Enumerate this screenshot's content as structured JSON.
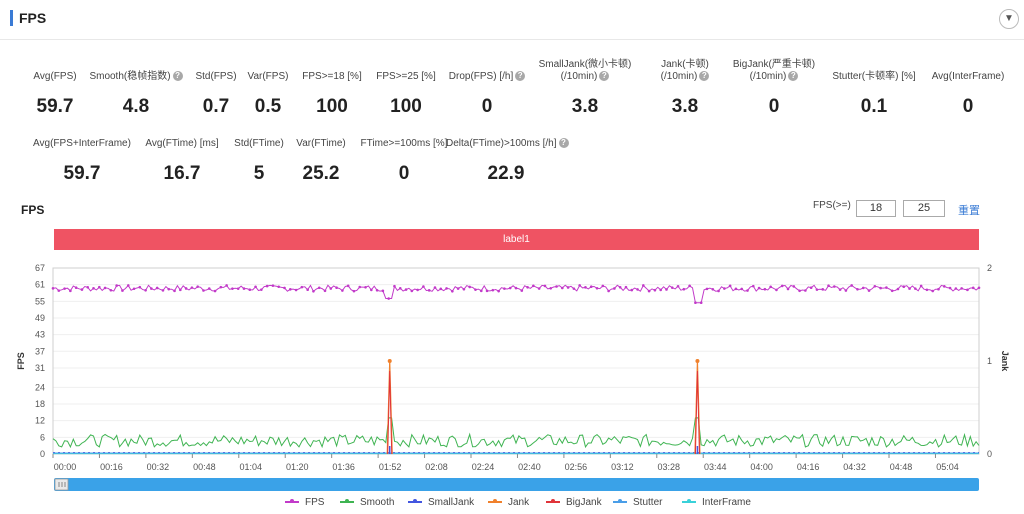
{
  "header": {
    "title": "FPS",
    "collapse_icon": "chevron-down-icon"
  },
  "metrics_row1": [
    {
      "label": "Avg(FPS)",
      "value": "59.7",
      "help": false
    },
    {
      "label": "Smooth(稳帧指数)",
      "value": "4.8",
      "help": true
    },
    {
      "label": "Std(FPS)",
      "value": "0.7",
      "help": false
    },
    {
      "label": "Var(FPS)",
      "value": "0.5",
      "help": false
    },
    {
      "label": "FPS>=18 [%]",
      "value": "100",
      "help": false
    },
    {
      "label": "FPS>=25 [%]",
      "value": "100",
      "help": false
    },
    {
      "label": "Drop(FPS) [/h]",
      "value": "0",
      "help": true
    },
    {
      "label": "SmallJank(微小卡顿)",
      "label2": "(/10min)",
      "value": "3.8",
      "help": true
    },
    {
      "label": "Jank(卡顿)",
      "label2": "(/10min)",
      "value": "3.8",
      "help": true
    },
    {
      "label": "BigJank(严重卡顿)",
      "label2": "(/10min)",
      "value": "0",
      "help": true
    },
    {
      "label": "Stutter(卡顿率) [%]",
      "value": "0.1",
      "help": false
    },
    {
      "label": "Avg(InterFrame)",
      "value": "0",
      "help": false
    }
  ],
  "metrics_row2": [
    {
      "label": "Avg(FPS+InterFrame)",
      "value": "59.7",
      "help": false
    },
    {
      "label": "Avg(FTime) [ms]",
      "value": "16.7",
      "help": false
    },
    {
      "label": "Std(FTime)",
      "value": "5",
      "help": false
    },
    {
      "label": "Var(FTime)",
      "value": "25.2",
      "help": false
    },
    {
      "label": "FTime>=100ms [%]",
      "value": "0",
      "help": false
    },
    {
      "label": "Delta(FTime)>100ms [/h]",
      "value": "22.9",
      "help": true
    }
  ],
  "controls": {
    "chart_title": "FPS",
    "fps_threshold_label": "FPS(>=)",
    "fps_threshold_1": "18",
    "fps_threshold_2": "25",
    "reset_label": "重置",
    "label_band": "label1"
  },
  "colors": {
    "fps": "#c23ac9",
    "smooth": "#3fb452",
    "smalljank": "#4356e0",
    "jank": "#f0812c",
    "bigjank": "#e0343a",
    "stutter": "#4a9ee8",
    "interframe": "#3ad1d9",
    "label_band": "#ef5363",
    "accent": "#3a7bd5"
  },
  "chart_data": {
    "type": "line",
    "xlabel": "",
    "ylabel": "FPS",
    "y2label": "Jank",
    "ylim": [
      0,
      67
    ],
    "y_ticks": [
      0,
      6,
      12,
      18,
      24,
      31,
      37,
      43,
      49,
      55,
      61,
      67
    ],
    "y2lim": [
      0,
      2
    ],
    "y2_ticks": [
      0,
      1,
      2
    ],
    "x_ticks": [
      "00:00",
      "00:16",
      "00:32",
      "00:48",
      "01:04",
      "01:20",
      "01:36",
      "01:52",
      "02:08",
      "02:24",
      "02:40",
      "02:56",
      "03:12",
      "03:28",
      "03:44",
      "04:00",
      "04:16",
      "04:32",
      "04:48",
      "05:04"
    ],
    "x_range_seconds": [
      0,
      319
    ],
    "legend_position": "bottom",
    "series": [
      {
        "name": "FPS",
        "axis": "left",
        "typical": 59.7,
        "dips": [
          {
            "t": 116,
            "value": 56
          },
          {
            "t": 222,
            "value": 54.5
          }
        ]
      },
      {
        "name": "Smooth",
        "axis": "left",
        "typical": 4.8,
        "range": [
          1,
          8
        ],
        "spikes": [
          {
            "t": 116,
            "value": 13
          },
          {
            "t": 222,
            "value": 13
          }
        ]
      },
      {
        "name": "SmallJank",
        "axis": "left",
        "values": "0"
      },
      {
        "name": "Jank",
        "axis": "right",
        "points": [
          {
            "t": 116,
            "value": 1
          },
          {
            "t": 222,
            "value": 1
          }
        ]
      },
      {
        "name": "BigJank",
        "axis": "right",
        "values": "0"
      },
      {
        "name": "Stutter",
        "axis": "left",
        "values": "0"
      },
      {
        "name": "InterFrame",
        "axis": "left",
        "values": "0"
      }
    ]
  }
}
